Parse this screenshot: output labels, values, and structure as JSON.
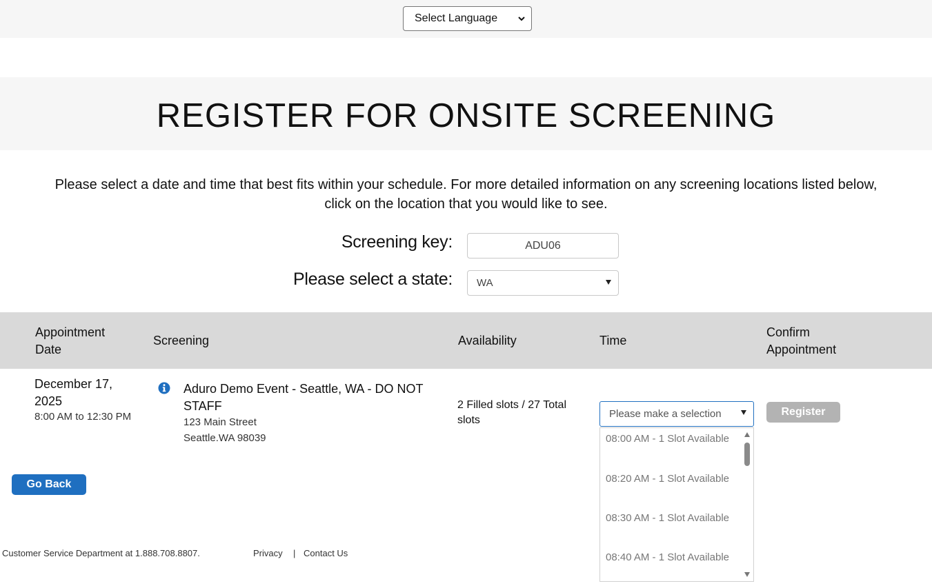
{
  "header": {
    "language_select": {
      "value": "Select Language",
      "icon": "chevron-down-icon"
    }
  },
  "title": "REGISTER FOR ONSITE SCREENING",
  "intro": {
    "line1": "Please select a date and time that best fits within your schedule. For more detailed information on any screening locations listed below,",
    "line2": "click on the location that you would like to see."
  },
  "form": {
    "screening_key_label": "Screening key:",
    "screening_key_value": "ADU06",
    "state_label": "Please select a state:",
    "state_value": "WA"
  },
  "table": {
    "headers": {
      "date_line1": "Appointment",
      "date_line2": "Date",
      "screening": "Screening",
      "availability": "Availability",
      "time": "Time",
      "confirm_line1": "Confirm",
      "confirm_line2": "Appointment"
    },
    "row": {
      "date": "December 17, 2025",
      "time_range": "8:00 AM to 12:30 PM",
      "event_name": "Aduro Demo Event - Seattle, WA - DO NOT STAFF",
      "address_line1": "123 Main Street",
      "address_line2": "Seattle.WA 98039",
      "availability": "2 Filled slots / 27 Total slots",
      "time_placeholder": "Please make a selection",
      "register_label": "Register"
    },
    "time_options": [
      "08:00 AM - 1 Slot Available",
      "08:20 AM - 1 Slot Available",
      "08:30 AM - 1 Slot Available",
      "08:40 AM - 1 Slot Available"
    ]
  },
  "go_back_label": "Go Back",
  "footer": {
    "customer_service": "Customer Service Department at 1.888.708.8807.",
    "privacy": "Privacy",
    "separator": "|",
    "contact": "Contact Us"
  },
  "colors": {
    "primary": "#1f6fc0",
    "header_band": "#f6f6f6",
    "table_header": "#d9d9d9",
    "disabled_button": "#b3b3b3"
  }
}
